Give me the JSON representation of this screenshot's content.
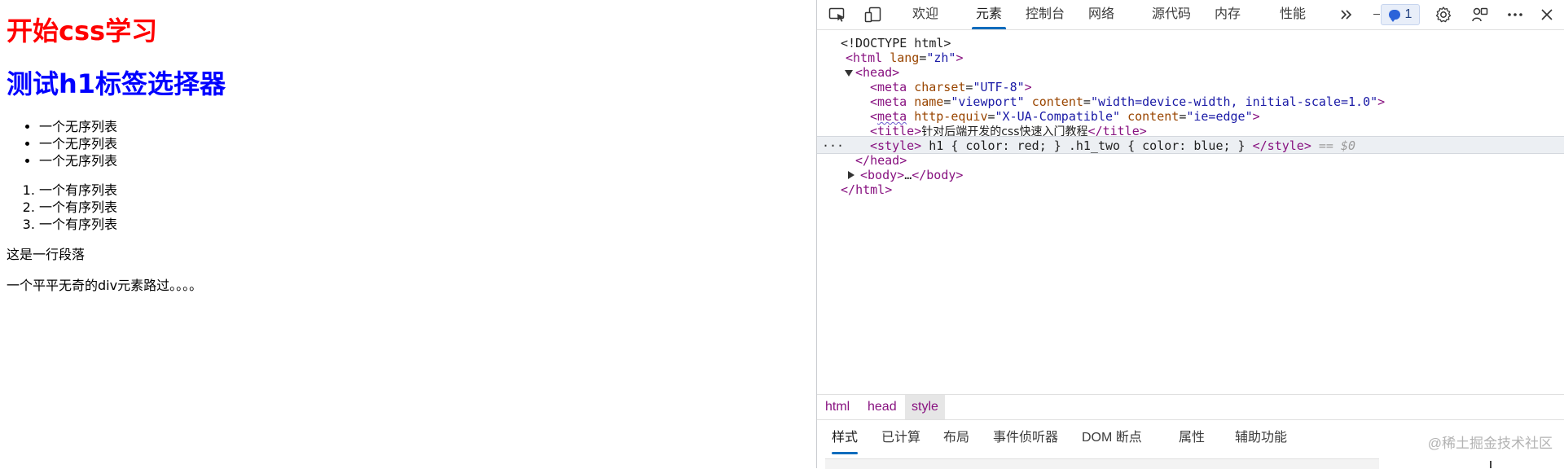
{
  "page": {
    "h1_first": "开始css学习",
    "h1_second": "测试h1标签选择器",
    "unordered_items": [
      "一个无序列表",
      "一个无序列表",
      "一个无序列表"
    ],
    "ordered_items": [
      "一个有序列表",
      "一个有序列表",
      "一个有序列表"
    ],
    "paragraph": "这是一行段落",
    "div_text": "一个平平无奇的div元素路过。。。。",
    "colors": {
      "h1": "#ff0000",
      "h1_two": "#0000ff"
    }
  },
  "devtools": {
    "tabs": [
      {
        "label": "欢迎",
        "active": false
      },
      {
        "label": "元素",
        "active": true
      },
      {
        "label": "控制台",
        "active": false
      },
      {
        "label": "网络",
        "active": false
      },
      {
        "label": "源代码",
        "active": false
      },
      {
        "label": "内存",
        "active": false
      },
      {
        "label": "性能",
        "active": false
      }
    ],
    "issues_count": "1",
    "icons": [
      "inspect-element-icon",
      "device-emulation-icon",
      "more-tabs-icon",
      "issues-icon",
      "settings-icon",
      "customize-icon",
      "more-options-icon",
      "close-icon"
    ],
    "dom": {
      "doctype": "<!DOCTYPE html>",
      "html_open_tag": "html",
      "html_lang_attr": "lang",
      "html_lang_value": "\"zh\"",
      "head_tag": "head",
      "meta1": {
        "attr": "charset",
        "value": "\"UTF-8\""
      },
      "meta2": {
        "attr1": "name",
        "value1": "\"viewport\"",
        "attr2": "content",
        "value2": "\"width=device-width, initial-scale=1.0\""
      },
      "meta3": {
        "attr1": "http-equiv",
        "value1": "\"X-UA-Compatible\"",
        "attr2": "content",
        "value2": "\"ie=edge\""
      },
      "title_text": "针对后端开发的css快速入门教程",
      "style_text": " h1 { color: red; } .h1_two { color: blue; } ",
      "selected_marker": "== $0",
      "body_collapsed": "…",
      "row_dots": "···"
    },
    "breadcrumbs": [
      {
        "label": "html",
        "active": false
      },
      {
        "label": "head",
        "active": false
      },
      {
        "label": "style",
        "active": true
      }
    ],
    "bottom_tabs": [
      {
        "label": "样式",
        "active": true
      },
      {
        "label": "已计算",
        "active": false
      },
      {
        "label": "布局",
        "active": false
      },
      {
        "label": "事件侦听器",
        "active": false
      },
      {
        "label": "DOM 断点",
        "active": false
      },
      {
        "label": "属性",
        "active": false
      },
      {
        "label": "辅助功能",
        "active": false
      }
    ],
    "watermark": "@稀土掘金技术社区",
    "accent_color": "#0f6cbd"
  }
}
